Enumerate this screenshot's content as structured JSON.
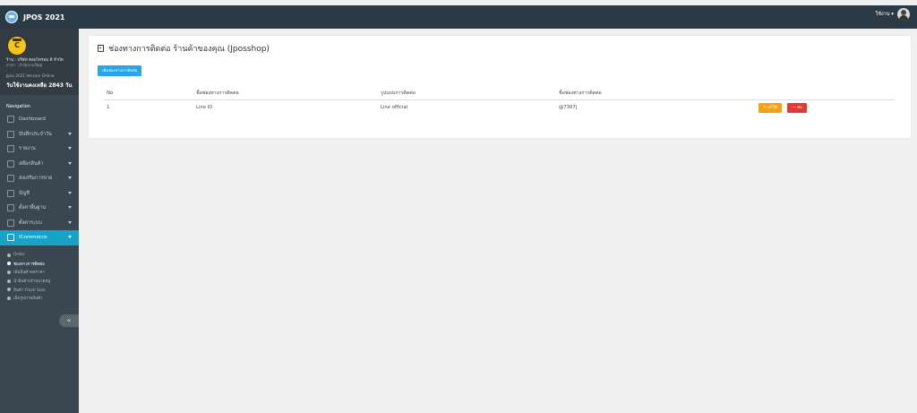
{
  "app": {
    "name": "JPOS 2021",
    "user_label": "ใช้งาน ▾"
  },
  "profile": {
    "shop": "ร้าน : บริษัท คอมไทรอน ดี จำกัด",
    "branch": "สาขา : สำนักงานใหญ่",
    "version": "Jpos 2021 Version Online",
    "remaining": "วันใช้งานคงเหลือ 2843 วัน"
  },
  "nav": {
    "header": "Navigation",
    "items": [
      {
        "label": "Dashboard"
      },
      {
        "label": "บันทึกประจำวัน"
      },
      {
        "label": "รายงาน"
      },
      {
        "label": "สต๊อกสินค้า"
      },
      {
        "label": "ส่งเสริมการขาย"
      },
      {
        "label": "บัญชี"
      },
      {
        "label": "ตั้งค่าพื้นฐาน"
      },
      {
        "label": "ตั้งค่าระบบ"
      },
      {
        "label": "ICommerce"
      }
    ],
    "sub": [
      {
        "label": "Order"
      },
      {
        "label": "ช่องทางการติดต่อ"
      },
      {
        "label": "เพิ่มสินค้าลดราคา"
      },
      {
        "label": "นำสินค้าเข้าหมวดหมู่"
      },
      {
        "label": "สินค้า Flash Sale"
      },
      {
        "label": "เพิ่มรูปภาพสินค้า"
      }
    ],
    "collapse": "«"
  },
  "page": {
    "title": "ช่องทางการติดต่อ ร้านค้าของคุณ (Jposshop)",
    "add_button": "เพิ่มช่องทางการติดต่อ"
  },
  "table": {
    "headers": [
      "No",
      "ชื่อช่องทางการติดต่อ",
      "รูปแบบการติดต่อ",
      "ชื่อช่องทางการติดต่อ"
    ],
    "rows": [
      {
        "no": "1",
        "name": "Line ID",
        "type": "Line official",
        "value": "@7307j",
        "edit": "แก้ไข",
        "delete": "ลบ"
      }
    ]
  },
  "colors": {
    "topbar": "#2b3a45",
    "sidebar": "#3b4750",
    "active": "#17a2c7",
    "primary": "#2aa6e8",
    "warning": "#f7a010",
    "danger": "#e53935"
  },
  "icons": [
    "dashboard-icon",
    "calendar-icon",
    "report-icon",
    "stock-icon",
    "promotion-icon",
    "account-icon",
    "settings-icon",
    "wrench-icon",
    "phone-icon",
    "pencil-icon",
    "minus-icon"
  ]
}
